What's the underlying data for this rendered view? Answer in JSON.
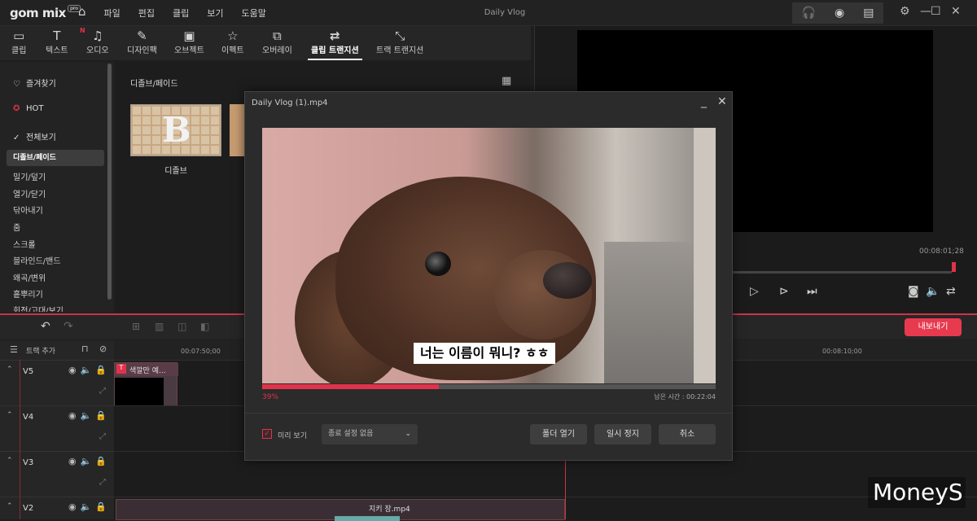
{
  "app": {
    "logo": "gom mix",
    "logo_badge": "pro",
    "window_title": "Daily Vlog"
  },
  "menu": {
    "home": "⌂",
    "items": [
      "파일",
      "편집",
      "클립",
      "보기",
      "도움말"
    ]
  },
  "tabs": [
    {
      "label": "클립",
      "icon": "▭"
    },
    {
      "label": "텍스트",
      "icon": "T"
    },
    {
      "label": "오디오",
      "icon": "♫",
      "badge": "N"
    },
    {
      "label": "디자인팩",
      "icon": "✎"
    },
    {
      "label": "오브젝트",
      "icon": "▣"
    },
    {
      "label": "이펙트",
      "icon": "☆"
    },
    {
      "label": "오버레이",
      "icon": "⧉"
    },
    {
      "label": "클립 트랜지션",
      "icon": "⇄"
    },
    {
      "label": "트랙 트랜지션",
      "icon": "⤡"
    }
  ],
  "sidebar": {
    "favorites": [
      {
        "icon": "♡",
        "label": "즐겨찾기"
      },
      {
        "icon": "✪",
        "label": "HOT"
      },
      {
        "icon": "✓",
        "label": "전체보기"
      }
    ],
    "items": [
      "디졸브/페이드",
      "밀기/덮기",
      "열기/닫기",
      "닦아내기",
      "줌",
      "스크롤",
      "블라인드/밴드",
      "왜곡/변위",
      "흩뿌리기",
      "회전/고대/보기"
    ]
  },
  "content": {
    "title": "디졸브/페이드",
    "thumb_label": "디졸브",
    "thumb_letter": "B"
  },
  "preview": {
    "time": "00:08:01;28"
  },
  "export_label": "내보내기",
  "timeline": {
    "add_track": "트랙 추가",
    "ruler": [
      "00:07:50;00",
      "00:08:10;00"
    ],
    "tracks": [
      "V5",
      "V4",
      "V3",
      "V2"
    ],
    "clip_v5": "색깔만 예...",
    "clip_v2": "지키 장.mp4"
  },
  "dialog": {
    "title": "Daily Vlog (1).mp4",
    "subtitle": "너는 이름이 뭐니? ㅎㅎ",
    "percent_label": "39%",
    "progress": 0.39,
    "remaining": "남은 시간 : 00:22:04",
    "preview_label": "미리 보기",
    "select_value": "종료 설정 없음",
    "buttons": [
      "폴더 열기",
      "일시 정지",
      "취소"
    ]
  },
  "watermark": "MoneyS",
  "colors": {
    "accent": "#e0334b"
  }
}
